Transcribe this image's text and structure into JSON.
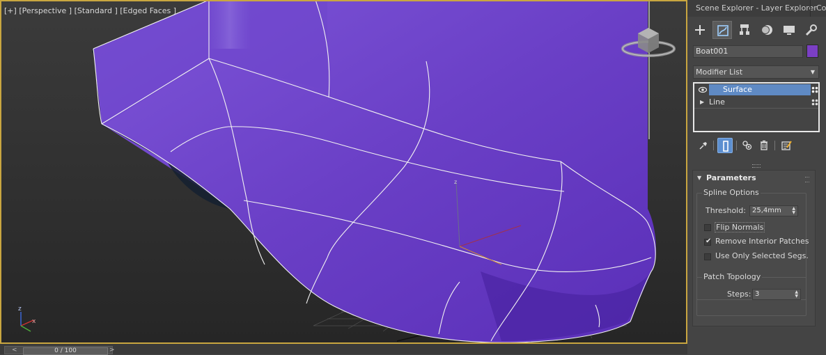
{
  "viewport": {
    "label_parts": [
      "[+]",
      "[Perspective ]",
      "[Standard ]",
      "[Edged Faces ]"
    ],
    "gizmo_axis_label": "z",
    "triad_labels": {
      "z": "z",
      "x": "x"
    },
    "object_color": "#6a3fc6",
    "border_color": "#c9a640"
  },
  "timeline": {
    "prev": "<",
    "next": ">",
    "frame_text": "0 / 100"
  },
  "panel": {
    "tabs": [
      "Scene Explorer - Layer Explorer",
      "Command Panel"
    ],
    "icon_buttons": [
      "create-icon",
      "modify-icon",
      "hierarchy-icon",
      "motion-icon",
      "display-icon",
      "utilities-icon"
    ],
    "object_name": "Boat001",
    "object_color": "#7b3fc4",
    "modifier_list": "Modifier List",
    "stack": [
      {
        "label": "Surface",
        "selected": true
      },
      {
        "label": "Line",
        "selected": false
      }
    ],
    "rollout": {
      "title": "Parameters",
      "spline_options": {
        "title": "Spline Options",
        "threshold_label": "Threshold:",
        "threshold_value": "25,4mm",
        "flip_normals": {
          "label": "Flip Normals",
          "checked": false
        },
        "remove_interior": {
          "label": "Remove Interior Patches",
          "checked": true
        },
        "use_only_selected": {
          "label": "Use Only Selected Segs.",
          "checked": false
        }
      },
      "patch_topology": {
        "title": "Patch Topology",
        "steps_label": "Steps:",
        "steps_value": "3"
      }
    }
  }
}
